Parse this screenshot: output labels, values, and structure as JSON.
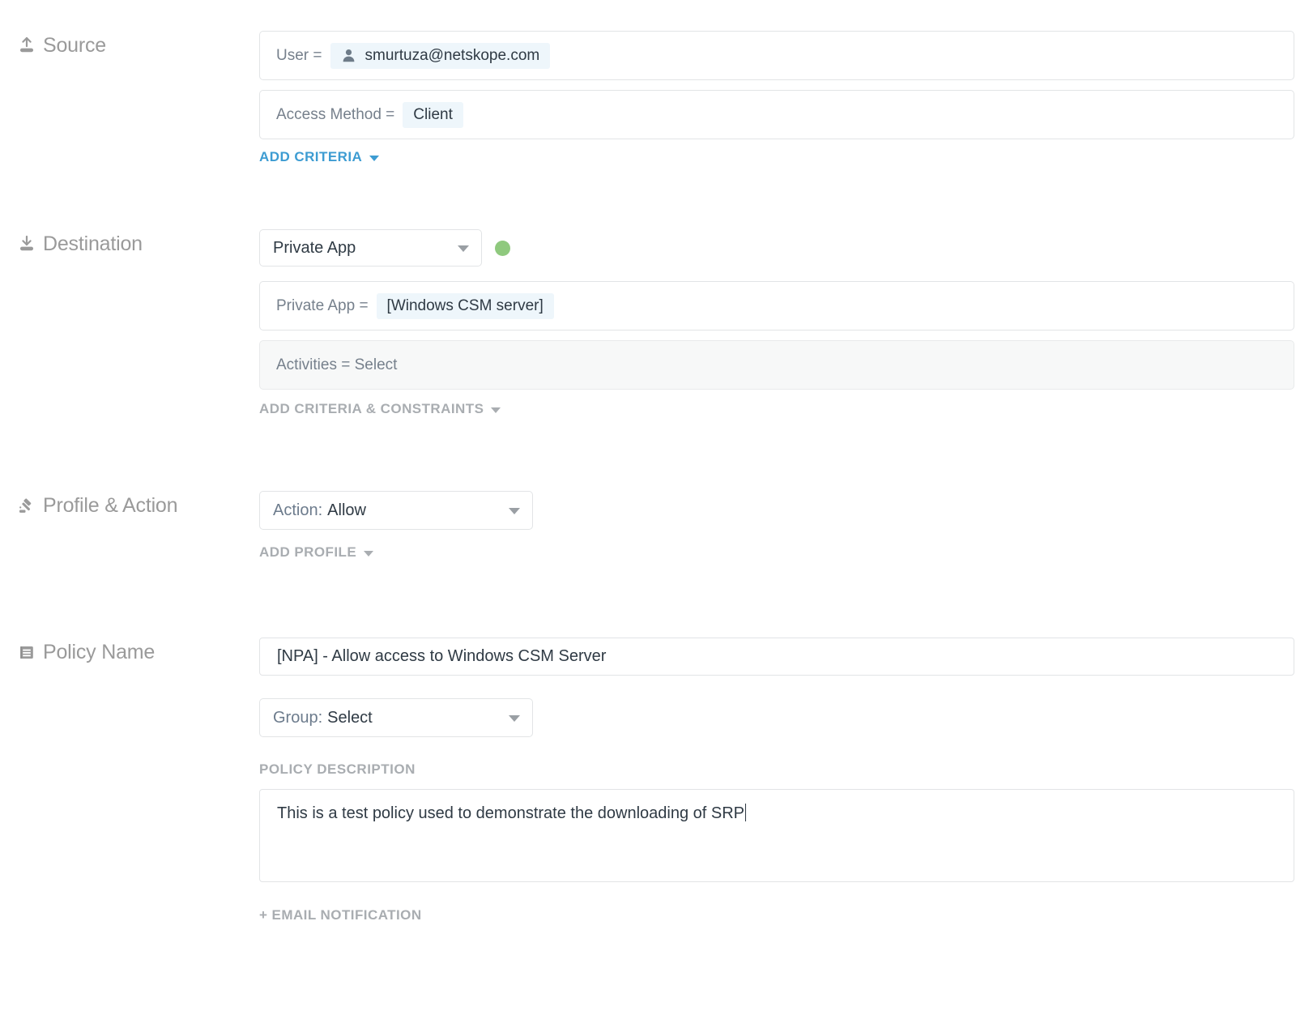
{
  "theme": {
    "link_blue": "#3d9cd2",
    "muted_grey": "#a9adb1",
    "label_grey": "#9a9a9a",
    "chip_bg": "#eef6fb",
    "status_green": "#8fc97e",
    "border": "#e2e4e6",
    "disabled_bg": "#f7f8f8"
  },
  "source": {
    "label": "Source",
    "icon": "upload-icon",
    "criteria": [
      {
        "key": "User =",
        "value": "smurtuza@netskope.com",
        "chip_icon": "user-icon"
      },
      {
        "key": "Access Method =",
        "value": "Client",
        "chip_icon": ""
      }
    ],
    "add_criteria_label": "ADD CRITERIA"
  },
  "destination": {
    "label": "Destination",
    "icon": "download-icon",
    "type_select": {
      "value": "Private App",
      "status_dot_color": "#8fc97e"
    },
    "criteria": [
      {
        "key": "Private App =",
        "value": "[Windows CSM server]",
        "chip_icon": ""
      }
    ],
    "activities_row": "Activities = Select",
    "add_criteria_label": "ADD CRITERIA & CONSTRAINTS"
  },
  "profile_action": {
    "label": "Profile & Action",
    "icon": "gavel-icon",
    "action_select": {
      "prefix": "Action:",
      "value": "Allow"
    },
    "add_profile_label": "ADD PROFILE"
  },
  "policy": {
    "label": "Policy Name",
    "icon": "document-icon",
    "name_value": "[NPA] - Allow access to Windows CSM Server",
    "group_select": {
      "prefix": "Group:",
      "value": "Select"
    },
    "description_caption": "POLICY DESCRIPTION",
    "description_value": "This is a test policy used to demonstrate the downloading of SRP",
    "email_notification_label": "+ EMAIL NOTIFICATION"
  }
}
